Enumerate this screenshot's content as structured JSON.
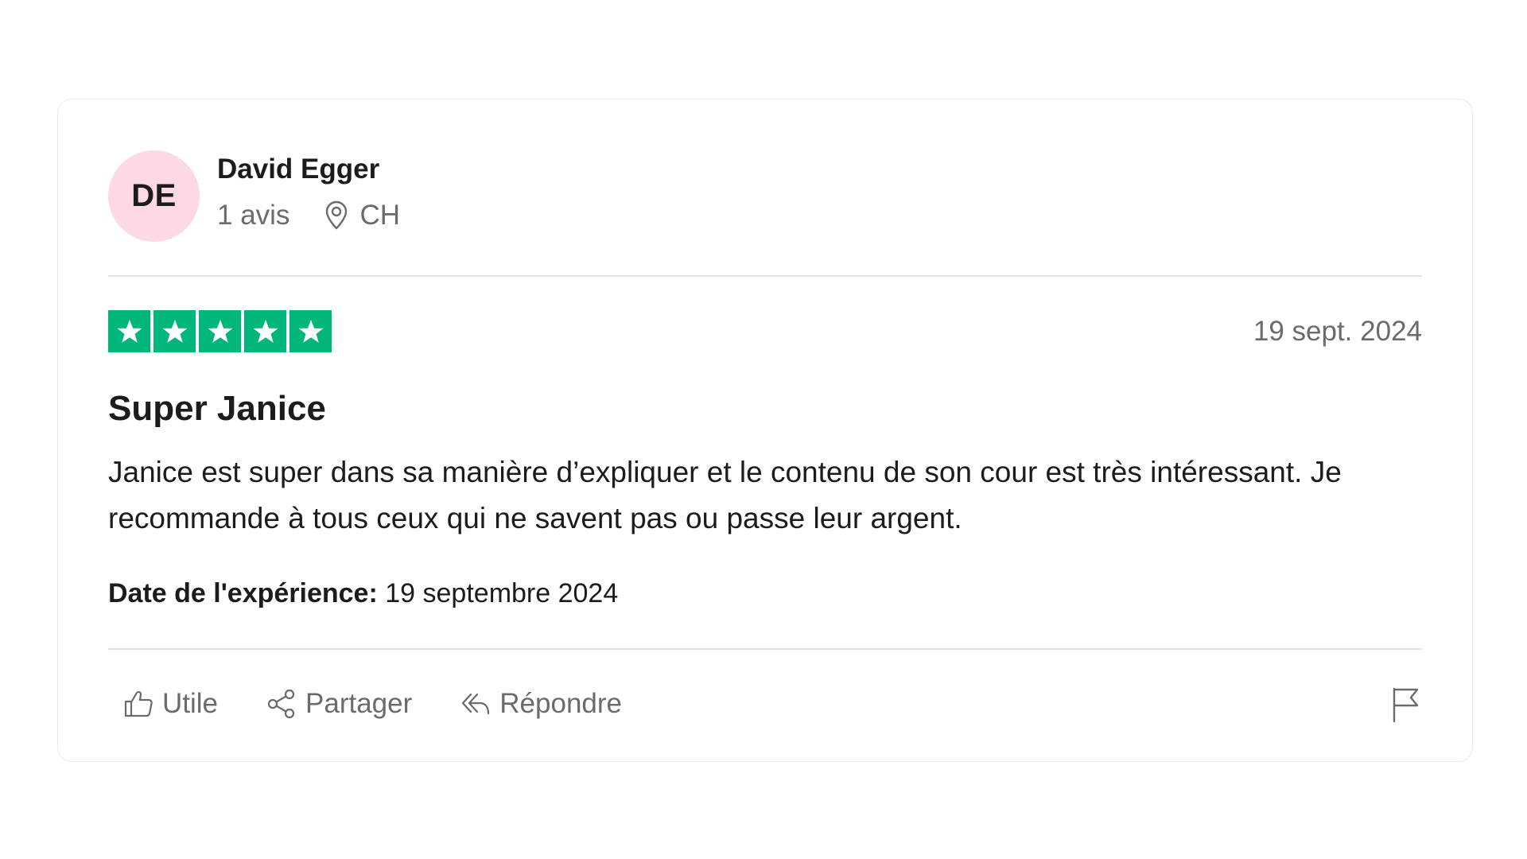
{
  "reviewer": {
    "initials": "DE",
    "name": "David Egger",
    "review_count": "1 avis",
    "country": "CH",
    "avatar_color": "#fcd9e4"
  },
  "review": {
    "rating": 5,
    "max_rating": 5,
    "star_color": "#00b67a",
    "date": "19 sept. 2024",
    "title": "Super Janice",
    "body": "Janice est super dans sa manière d’expliquer et le contenu de son cour est très intéressant. Je recommande à tous ceux qui ne savent pas ou passe leur argent.",
    "experience_label": "Date de l'expérience:",
    "experience_date": "19 septembre 2024"
  },
  "actions": {
    "useful": "Utile",
    "share": "Partager",
    "reply": "Répondre"
  },
  "icons": {
    "location": "location-pin-icon",
    "useful": "thumbs-up-icon",
    "share": "share-icon",
    "reply": "reply-icon",
    "report": "flag-icon"
  }
}
